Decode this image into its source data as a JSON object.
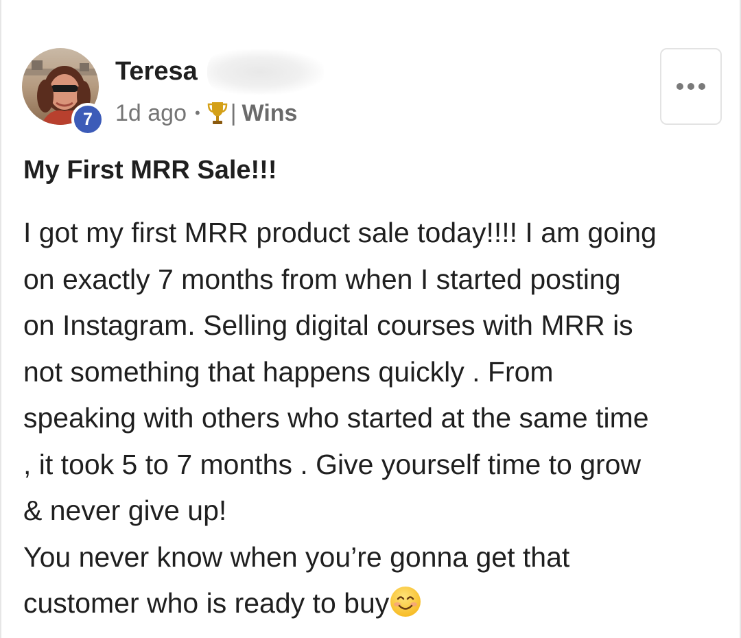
{
  "post": {
    "author": {
      "name": "Teresa",
      "level": "7"
    },
    "meta": {
      "time_ago": "1d ago",
      "separator": "•",
      "category_divider": "|",
      "category": "Wins",
      "category_icon": "trophy-icon"
    },
    "menu_icon": "more-horizontal-icon",
    "title": "My First MRR Sale!!!",
    "body_lines": [
      "I got my first MRR product sale today!!!! I am going",
      "on exactly 7 months from when I started posting",
      "on Instagram. Selling digital courses with MRR is",
      "not something that happens quickly . From",
      "speaking with others who started at the same time",
      ", it took 5 to 7 months . Give yourself time to grow",
      "& never give up!",
      "You never know when you’re gonna get that",
      "customer who is ready to buy"
    ],
    "trailing_emoji": "smiling-face-emoji"
  },
  "colors": {
    "level_badge": "#3c5bb8",
    "text": "#1f1f1f",
    "muted": "#757575",
    "trophy": "#d4a017"
  }
}
